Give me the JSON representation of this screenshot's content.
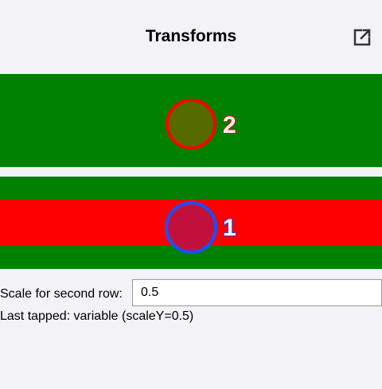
{
  "header": {
    "title": "Transforms",
    "open_icon": "external-link-icon"
  },
  "rows": [
    {
      "label": "2",
      "background_color": "#008000",
      "circle_fill": "#556b00",
      "circle_stroke": "#ff0000"
    },
    {
      "label": "1",
      "background_color": "#008000",
      "band_color": "#ff0000",
      "circle_fill": "#c2103c",
      "circle_stroke": "#1a4fff"
    }
  ],
  "scale_field": {
    "label": "Scale for second row:",
    "value": "0.5"
  },
  "status": {
    "text": "Last tapped: variable (scaleY=0.5)"
  }
}
